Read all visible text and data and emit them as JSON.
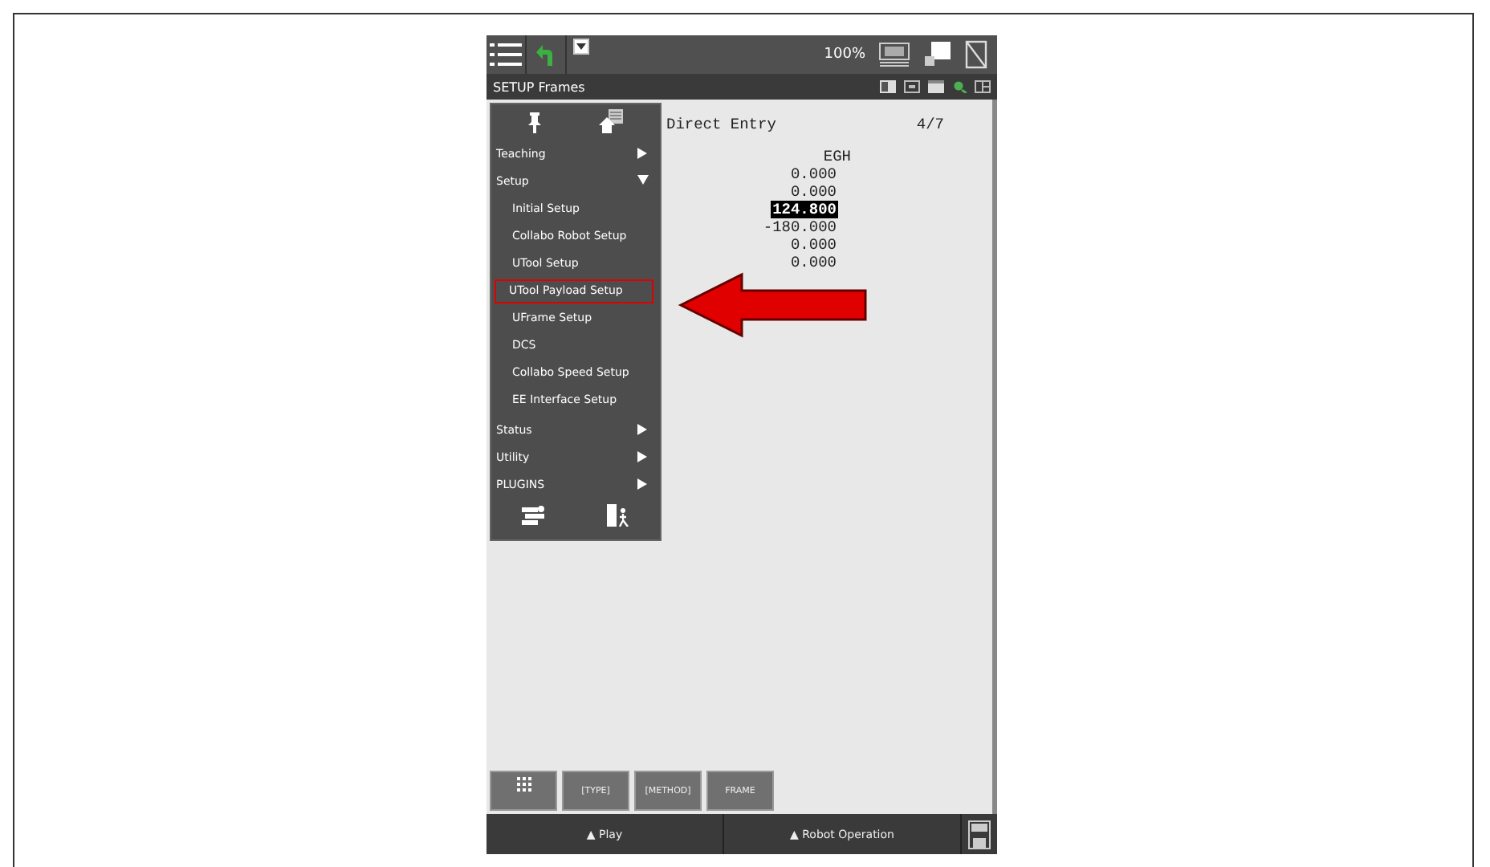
{
  "status_bar": {
    "zoom": "100%"
  },
  "title_bar": {
    "title": "SETUP Frames"
  },
  "content": {
    "heading": "Direct Entry",
    "page": "4/7",
    "column": "EGH",
    "values": [
      {
        "text": "0.000",
        "selected": false
      },
      {
        "text": "0.000",
        "selected": false
      },
      {
        "text": "124.800",
        "selected": true
      },
      {
        "text": "-180.000",
        "selected": false
      },
      {
        "text": "0.000",
        "selected": false
      },
      {
        "text": "0.000",
        "selected": false
      }
    ]
  },
  "menu": {
    "items": [
      {
        "label": "Teaching",
        "expanded": false
      },
      {
        "label": "Setup",
        "expanded": true,
        "children": [
          {
            "label": "Initial Setup",
            "highlighted": false
          },
          {
            "label": "Collabo Robot Setup",
            "highlighted": false
          },
          {
            "label": "UTool Setup",
            "highlighted": false
          },
          {
            "label": "UTool Payload Setup",
            "highlighted": true
          },
          {
            "label": "UFrame Setup",
            "highlighted": false
          },
          {
            "label": "DCS",
            "highlighted": false
          },
          {
            "label": "Collabo Speed Setup",
            "highlighted": false
          },
          {
            "label": "EE Interface Setup",
            "highlighted": false
          }
        ]
      },
      {
        "label": "Status",
        "expanded": false
      },
      {
        "label": "Utility",
        "expanded": false
      },
      {
        "label": "PLUGINS",
        "expanded": false
      }
    ]
  },
  "function_keys": [
    "[TYPE]",
    "[METHOD]",
    "FRAME"
  ],
  "bottom_bar": {
    "buttons": [
      "▲ Play",
      "▲ Robot Operation"
    ]
  }
}
